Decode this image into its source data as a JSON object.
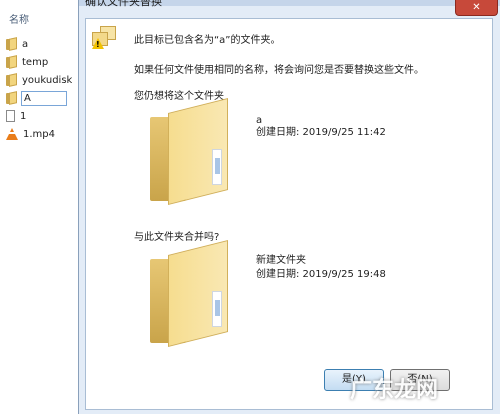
{
  "explorer": {
    "column_header": "名称",
    "items": [
      {
        "label": "a",
        "icon": "folder-icon"
      },
      {
        "label": "temp",
        "icon": "folder-icon"
      },
      {
        "label": "youkudisk",
        "icon": "folder-icon"
      },
      {
        "label": "A",
        "icon": "folder-icon",
        "editing": true
      },
      {
        "label": "1",
        "icon": "file-icon"
      },
      {
        "label": "1.mp4",
        "icon": "vlc-media-icon"
      }
    ]
  },
  "dialog": {
    "title": "确认文件夹替换",
    "close_label": "✕",
    "message_line1": "此目标已包含名为“a”的文件夹。",
    "message_line2": "如果任何文件使用相同的名称，将会询问您是否要替换这些文件。",
    "prompt_replace": "您仍想将这个文件夹",
    "existing": {
      "name": "a",
      "created": "创建日期: 2019/9/25 11:42"
    },
    "prompt_merge": "与此文件夹合并吗?",
    "incoming": {
      "name": "新建文件夹",
      "created": "创建日期: 2019/9/25 19:48"
    },
    "yes_button": "是(Y)",
    "no_button": "否(N)"
  },
  "watermark": "广东龙网"
}
